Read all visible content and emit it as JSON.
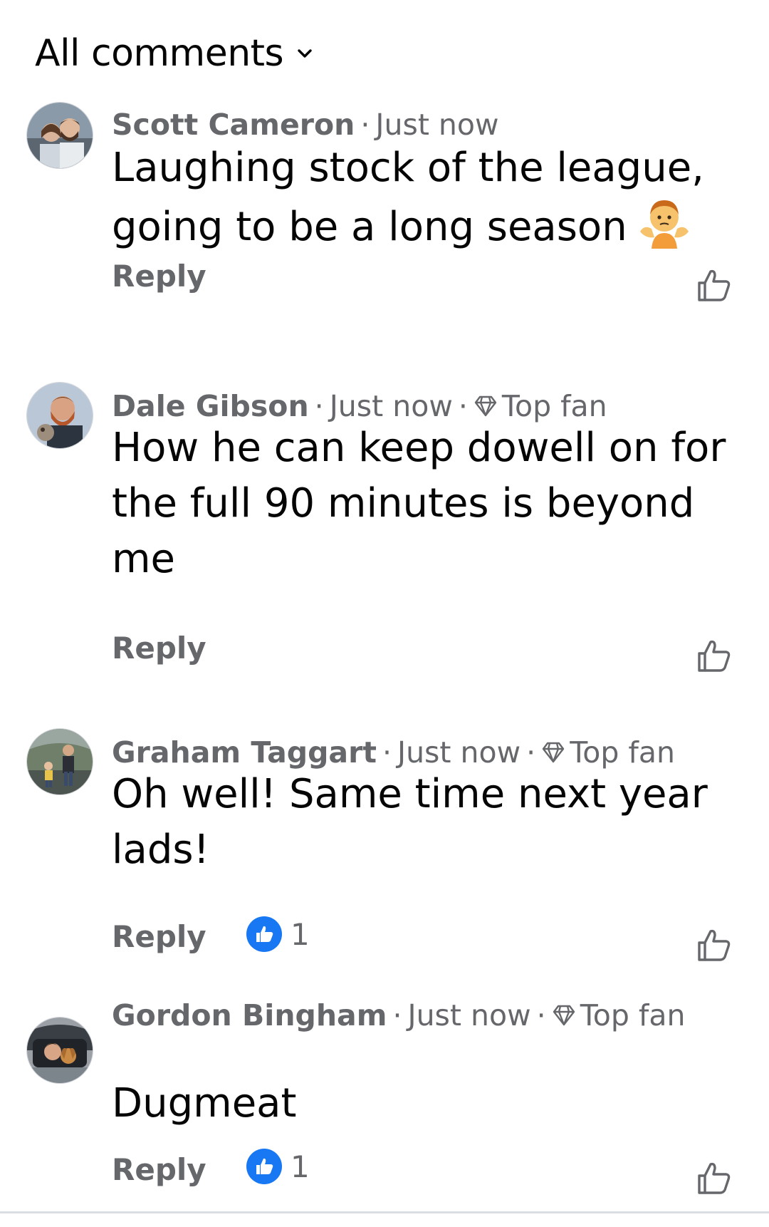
{
  "header": {
    "title": "All comments",
    "chevron_icon": "chevron-down-icon"
  },
  "comments": [
    {
      "author": "Scott Cameron",
      "sep1": "·",
      "time": "Just now",
      "text": "Laughing stock of the league, going to be a long season",
      "emoji": "person-shrugging-emoji",
      "reply_label": "Reply",
      "like_icon": "thumbs-up-outline-icon"
    },
    {
      "author": "Dale Gibson",
      "sep1": "·",
      "time": "Just now",
      "sep2": "·",
      "badge_icon": "diamond-icon",
      "badge": "Top fan",
      "text": "How he can keep dowell on for the full 90 minutes is beyond me",
      "reply_label": "Reply",
      "like_icon": "thumbs-up-outline-icon"
    },
    {
      "author": "Graham Taggart",
      "sep1": "·",
      "time": "Just now",
      "sep2": "·",
      "badge_icon": "diamond-icon",
      "badge": "Top fan",
      "text": "Oh well! Same time next year lads!",
      "reply_label": "Reply",
      "reaction_icon": "like-reaction-icon",
      "reaction_count": "1",
      "like_icon": "thumbs-up-outline-icon"
    },
    {
      "author": "Gordon Bingham",
      "sep1": "·",
      "time": "Just now",
      "sep2": "·",
      "badge_icon": "diamond-icon",
      "badge": "Top fan",
      "text": "Dugmeat",
      "reply_label": "Reply",
      "reaction_icon": "like-reaction-icon",
      "reaction_count": "1",
      "like_icon": "thumbs-up-outline-icon"
    }
  ],
  "colors": {
    "meta_text": "#65676b",
    "body_text": "#050505",
    "reaction_blue": "#1877f2"
  }
}
